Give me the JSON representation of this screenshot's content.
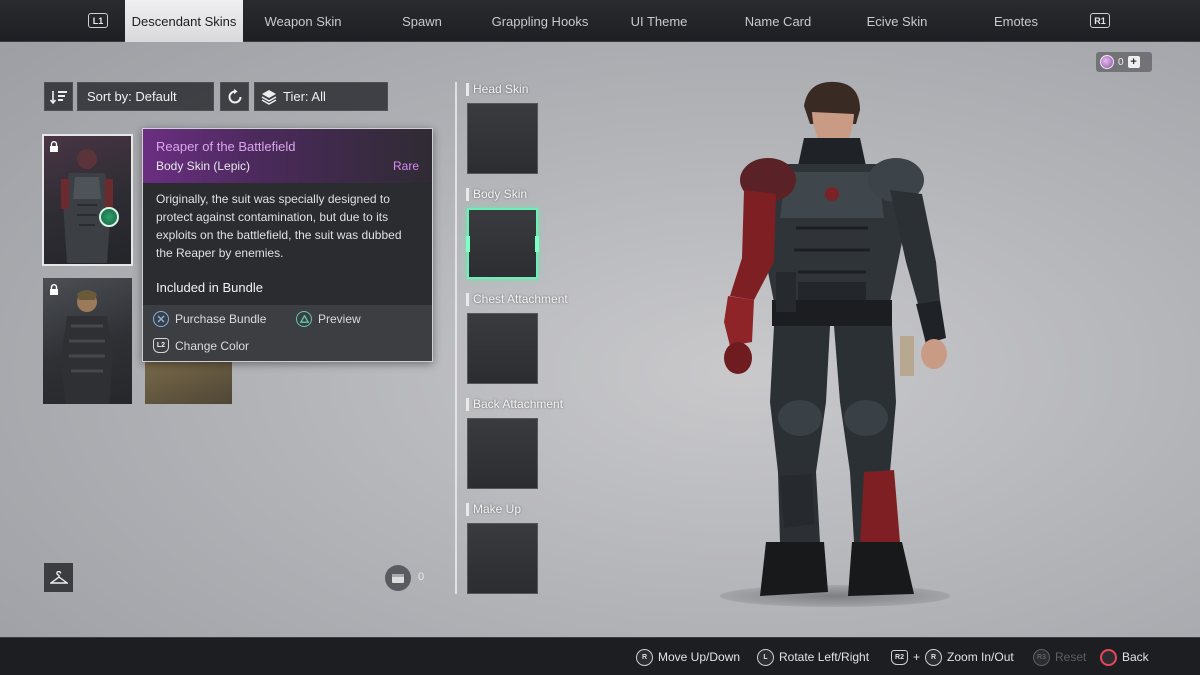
{
  "tabs": {
    "left_bumper": "L1",
    "right_bumper": "R1",
    "items": [
      {
        "label": "Descendant Skins"
      },
      {
        "label": "Weapon Skin"
      },
      {
        "label": "Spawn"
      },
      {
        "label": "Grappling Hooks"
      },
      {
        "label": "UI Theme"
      },
      {
        "label": "Name Card"
      },
      {
        "label": "Ecive Skin"
      },
      {
        "label": "Emotes"
      }
    ]
  },
  "currency": {
    "value": "0"
  },
  "filters": {
    "sort_label": "Sort by: Default",
    "tier_label": "Tier: All"
  },
  "tooltip": {
    "title": "Reaper of the Battlefield",
    "subtitle": "Body Skin (Lepic)",
    "rarity": "Rare",
    "description": "Originally, the suit was specially designed to protect against contamination, but due to its exploits on the battlefield, the suit was dubbed the Reaper by enemies.",
    "bundle_text": "Included in Bundle",
    "purchase_label": "Purchase Bundle",
    "preview_label": "Preview",
    "change_color_label": "Change Color",
    "change_color_key": "L2"
  },
  "inventory": {
    "count": "0"
  },
  "slots": [
    {
      "label": "Head Skin"
    },
    {
      "label": "Body Skin"
    },
    {
      "label": "Chest Attachment"
    },
    {
      "label": "Back Attachment"
    },
    {
      "label": "Make Up"
    }
  ],
  "hints": {
    "move_key": "R",
    "move": "Move Up/Down",
    "rotate_key": "L",
    "rotate": "Rotate Left/Right",
    "zoom_key1": "R2",
    "zoom_plus": "+",
    "zoom_key2": "R",
    "zoom": "Zoom In/Out",
    "reset_key": "R3",
    "reset": "Reset",
    "back": "Back"
  },
  "colors": {
    "accent_green": "#6df0b8",
    "rarity_purple": "#d58bf0",
    "back_red": "#e8455a"
  }
}
